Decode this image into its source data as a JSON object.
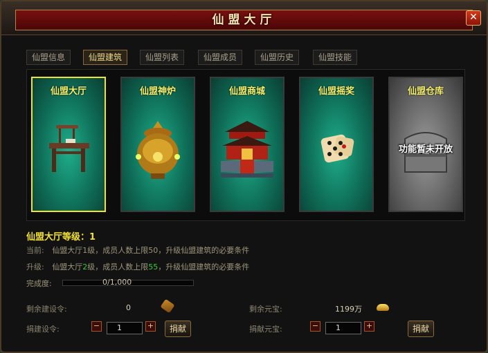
{
  "window": {
    "title": "仙盟大厅",
    "close_icon": "close-icon"
  },
  "tabs": [
    {
      "label": "仙盟信息",
      "active": false
    },
    {
      "label": "仙盟建筑",
      "active": true
    },
    {
      "label": "仙盟列表",
      "active": false
    },
    {
      "label": "仙盟成员",
      "active": false
    },
    {
      "label": "仙盟历史",
      "active": false
    },
    {
      "label": "仙盟技能",
      "active": false
    }
  ],
  "buildings": [
    {
      "title": "仙盟大厅",
      "icon": "desk-icon",
      "selected": true
    },
    {
      "title": "仙盟神炉",
      "icon": "furnace-icon",
      "selected": false
    },
    {
      "title": "仙盟商城",
      "icon": "palace-icon",
      "selected": false
    },
    {
      "title": "仙盟摇奖",
      "icon": "dice-icon",
      "selected": false
    },
    {
      "title": "仙盟仓库",
      "icon": "chest-icon",
      "selected": false,
      "overlay": "功能暂未开放"
    }
  ],
  "info": {
    "level_label": "仙盟大厅等级：",
    "level_value": "1",
    "current_label": "当前:",
    "current_text": "仙盟大厅1级，成员人数上限50，升级仙盟建筑的必要条件",
    "upgrade_label": "升级:",
    "upgrade_prefix": "仙盟大厅",
    "upgrade_level": "2",
    "upgrade_mid": "级，成员人数上限",
    "upgrade_limit": "55",
    "upgrade_suffix": "，升级仙盟建筑的必要条件",
    "progress_label": "完成度:",
    "progress_text": "0/1,000",
    "progress_fraction": 0
  },
  "resources": {
    "remaining_orders_label": "剩余建设令:",
    "remaining_orders_value": "0",
    "remaining_ingots_label": "剩余元宝:",
    "remaining_ingots_value": "1199万",
    "donate_orders_label": "捐建设令:",
    "donate_orders_value": "1",
    "donate_ingots_label": "捐献元宝:",
    "donate_ingots_value": "1",
    "minus": "−",
    "plus": "+",
    "donate_button": "捐献"
  },
  "colors": {
    "highlight": "#37d03a",
    "level": "#f2e130",
    "card_title": "#f6f06a",
    "selected_border": "#f2e42a"
  }
}
